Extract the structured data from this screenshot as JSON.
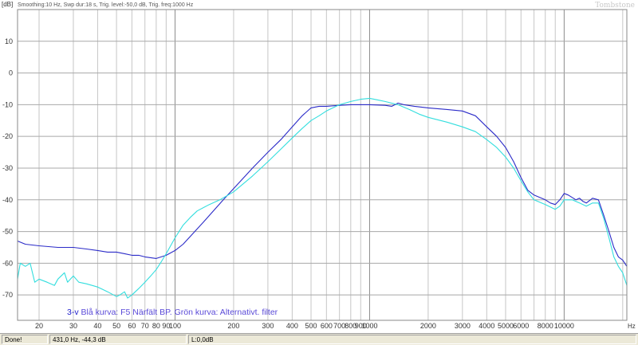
{
  "header": {
    "unit": "[dB]",
    "settings": "Smoothing:10 Hz, Swp dur:18 s, Trig. level:-50,0 dB, Trig. freq:1000 Hz",
    "brand": "Tombstone"
  },
  "annotation": {
    "prefix": "3-v ",
    "text": "Blå kurva: F5 Närfält BP. Grön kurva: Alternativt. filter",
    "prefix_color": "#2222cc",
    "text_color": "#5a4ad8"
  },
  "status": {
    "state": "Done!",
    "cursor": "431,0 Hz, -44,3 dB",
    "level": "L:0,0dB"
  },
  "chart_data": {
    "type": "line",
    "xscale": "log",
    "xlim": [
      15.5,
      21000
    ],
    "ylim": [
      -78,
      20
    ],
    "xunit": "Hz",
    "grid": true,
    "x_tick_labels": [
      {
        "x": 20,
        "label": "20"
      },
      {
        "x": 30,
        "label": "30"
      },
      {
        "x": 40,
        "label": "40"
      },
      {
        "x": 50,
        "label": "50"
      },
      {
        "x": 60,
        "label": "60"
      },
      {
        "x": 70,
        "label": "70"
      },
      {
        "x": 80,
        "label": "80"
      },
      {
        "x": 90,
        "label": "90"
      },
      {
        "x": 100,
        "label": "100"
      },
      {
        "x": 200,
        "label": "200"
      },
      {
        "x": 300,
        "label": "300"
      },
      {
        "x": 400,
        "label": "400"
      },
      {
        "x": 500,
        "label": "500"
      },
      {
        "x": 600,
        "label": "600"
      },
      {
        "x": 700,
        "label": "700"
      },
      {
        "x": 800,
        "label": "800"
      },
      {
        "x": 900,
        "label": "900"
      },
      {
        "x": 1000,
        "label": "1000"
      },
      {
        "x": 2000,
        "label": "2000"
      },
      {
        "x": 3000,
        "label": "3000"
      },
      {
        "x": 4000,
        "label": "4000"
      },
      {
        "x": 5000,
        "label": "5000"
      },
      {
        "x": 6000,
        "label": "6000"
      },
      {
        "x": 8000,
        "label": "8000"
      },
      {
        "x": 10000,
        "label": "10000"
      }
    ],
    "y_ticks": [
      10,
      0,
      -10,
      -20,
      -30,
      -40,
      -50,
      -60,
      -70
    ],
    "series": [
      {
        "color": "#2b2bc8",
        "points": [
          [
            15.5,
            -53
          ],
          [
            17,
            -54
          ],
          [
            20,
            -54.5
          ],
          [
            25,
            -55
          ],
          [
            30,
            -55
          ],
          [
            35,
            -55.5
          ],
          [
            40,
            -56
          ],
          [
            45,
            -56.5
          ],
          [
            50,
            -56.5
          ],
          [
            55,
            -57
          ],
          [
            60,
            -57.5
          ],
          [
            65,
            -57.5
          ],
          [
            70,
            -58
          ],
          [
            80,
            -58.5
          ],
          [
            90,
            -57.5
          ],
          [
            100,
            -56
          ],
          [
            110,
            -54
          ],
          [
            120,
            -51.5
          ],
          [
            140,
            -47
          ],
          [
            160,
            -43
          ],
          [
            180,
            -39.5
          ],
          [
            200,
            -36.5
          ],
          [
            250,
            -30
          ],
          [
            300,
            -25
          ],
          [
            350,
            -21
          ],
          [
            400,
            -17
          ],
          [
            450,
            -13.5
          ],
          [
            500,
            -11
          ],
          [
            550,
            -10.5
          ],
          [
            600,
            -10.5
          ],
          [
            700,
            -10.2
          ],
          [
            800,
            -10
          ],
          [
            900,
            -10
          ],
          [
            1000,
            -10
          ],
          [
            1200,
            -10.2
          ],
          [
            1300,
            -10.5
          ],
          [
            1400,
            -9.5
          ],
          [
            1500,
            -10
          ],
          [
            1700,
            -10.5
          ],
          [
            2000,
            -11
          ],
          [
            2500,
            -11.5
          ],
          [
            3000,
            -12
          ],
          [
            3500,
            -13.5
          ],
          [
            4000,
            -17
          ],
          [
            4500,
            -20
          ],
          [
            5000,
            -23.5
          ],
          [
            5500,
            -28
          ],
          [
            6000,
            -33
          ],
          [
            6500,
            -37
          ],
          [
            7000,
            -38.5
          ],
          [
            8000,
            -40
          ],
          [
            8500,
            -41
          ],
          [
            9000,
            -41.5
          ],
          [
            9500,
            -40
          ],
          [
            10000,
            -38
          ],
          [
            10500,
            -38.5
          ],
          [
            11500,
            -40
          ],
          [
            12000,
            -39.5
          ],
          [
            12500,
            -40.5
          ],
          [
            13000,
            -41
          ],
          [
            14000,
            -39.5
          ],
          [
            15000,
            -40
          ],
          [
            16000,
            -45
          ],
          [
            17000,
            -50
          ],
          [
            18000,
            -55
          ],
          [
            19000,
            -58
          ],
          [
            20000,
            -59
          ],
          [
            21000,
            -61
          ]
        ]
      },
      {
        "color": "#33dede",
        "points": [
          [
            15.5,
            -65
          ],
          [
            16,
            -60
          ],
          [
            17,
            -61
          ],
          [
            18,
            -60
          ],
          [
            19,
            -66
          ],
          [
            20,
            -65
          ],
          [
            22,
            -66
          ],
          [
            24,
            -67
          ],
          [
            25,
            -65
          ],
          [
            27,
            -63
          ],
          [
            28,
            -66
          ],
          [
            30,
            -64
          ],
          [
            32,
            -66
          ],
          [
            35,
            -66.5
          ],
          [
            40,
            -67.5
          ],
          [
            45,
            -69
          ],
          [
            50,
            -70.5
          ],
          [
            52,
            -70
          ],
          [
            55,
            -69
          ],
          [
            57,
            -71
          ],
          [
            60,
            -70
          ],
          [
            65,
            -68
          ],
          [
            70,
            -66
          ],
          [
            75,
            -64
          ],
          [
            80,
            -62
          ],
          [
            85,
            -59.5
          ],
          [
            90,
            -57
          ],
          [
            100,
            -52
          ],
          [
            110,
            -48
          ],
          [
            120,
            -45.5
          ],
          [
            130,
            -43.5
          ],
          [
            150,
            -41.5
          ],
          [
            170,
            -40
          ],
          [
            200,
            -37.5
          ],
          [
            250,
            -32.5
          ],
          [
            300,
            -28
          ],
          [
            350,
            -24
          ],
          [
            400,
            -20.5
          ],
          [
            450,
            -17.5
          ],
          [
            500,
            -15
          ],
          [
            550,
            -13.5
          ],
          [
            600,
            -12
          ],
          [
            700,
            -10
          ],
          [
            800,
            -9
          ],
          [
            900,
            -8.3
          ],
          [
            1000,
            -8
          ],
          [
            1100,
            -8.5
          ],
          [
            1200,
            -9
          ],
          [
            1400,
            -10
          ],
          [
            1600,
            -11.5
          ],
          [
            1800,
            -13
          ],
          [
            2000,
            -14
          ],
          [
            2500,
            -15.5
          ],
          [
            3000,
            -17
          ],
          [
            3500,
            -18.5
          ],
          [
            4000,
            -21
          ],
          [
            4500,
            -23.5
          ],
          [
            5000,
            -26.5
          ],
          [
            5500,
            -30
          ],
          [
            6000,
            -34
          ],
          [
            6500,
            -37.5
          ],
          [
            7000,
            -40
          ],
          [
            8000,
            -41.5
          ],
          [
            9000,
            -43
          ],
          [
            9500,
            -42
          ],
          [
            10000,
            -40
          ],
          [
            11000,
            -40
          ],
          [
            12000,
            -41
          ],
          [
            13000,
            -42
          ],
          [
            14000,
            -41
          ],
          [
            15000,
            -41
          ],
          [
            16000,
            -46
          ],
          [
            17000,
            -52
          ],
          [
            18000,
            -58
          ],
          [
            19000,
            -61
          ],
          [
            20000,
            -63
          ],
          [
            21000,
            -67
          ]
        ]
      }
    ]
  }
}
